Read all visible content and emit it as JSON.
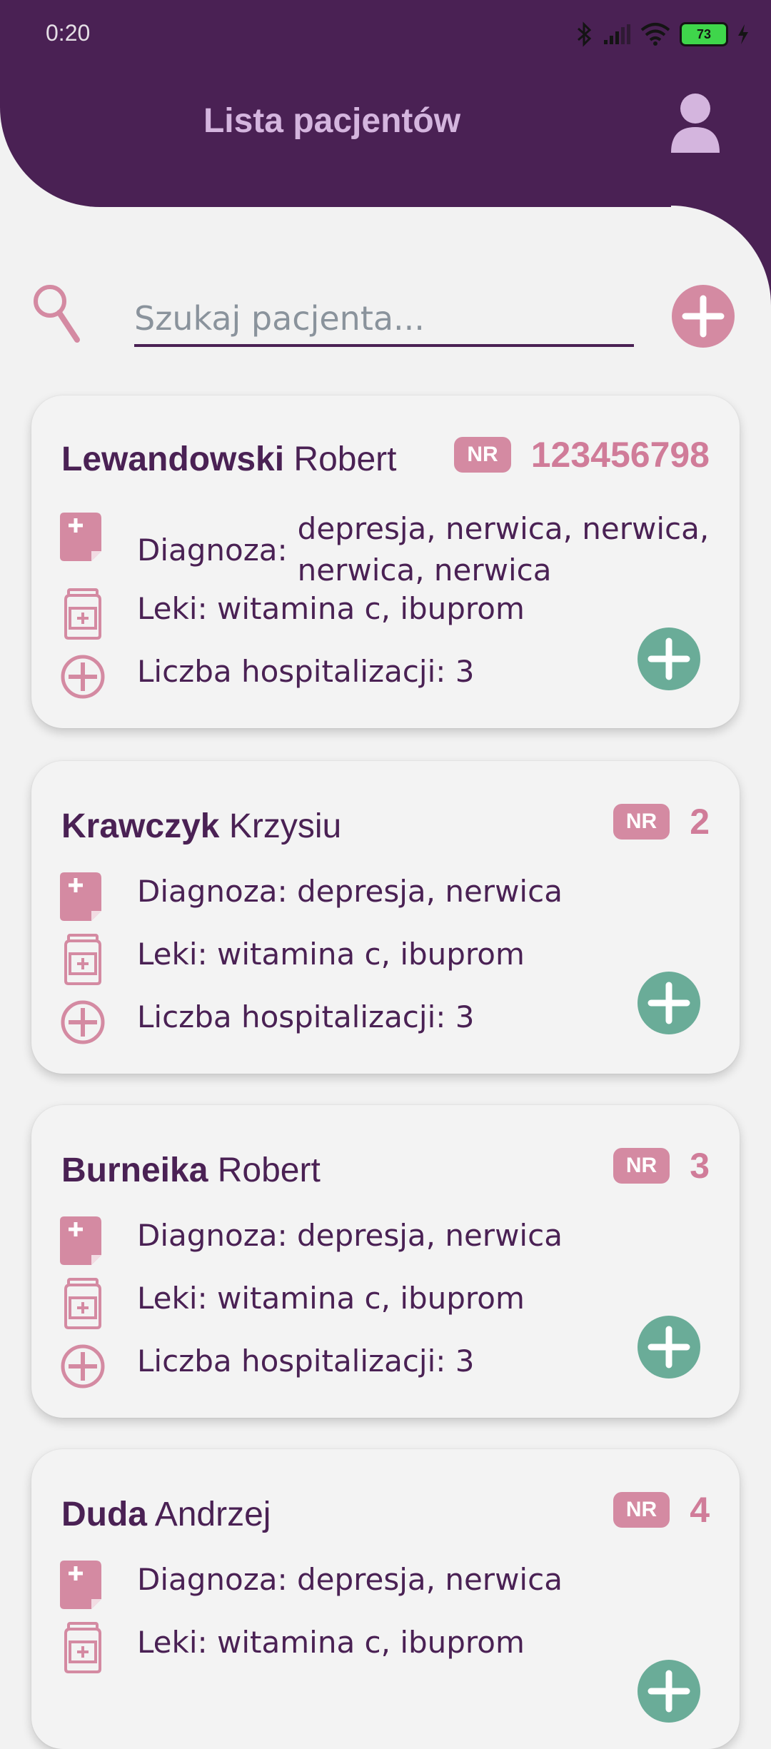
{
  "status_bar": {
    "time": "0:20",
    "battery": "73"
  },
  "header": {
    "title": "Lista pacjentów"
  },
  "search": {
    "placeholder": "Szukaj pacjenta..."
  },
  "labels": {
    "nr": "NR",
    "diagnosis": "Diagnoza:",
    "meds": "Leki:",
    "hospitalizations": "Liczba hospitalizacji:"
  },
  "colors": {
    "header_bg": "#4a2154",
    "accent_pink": "#d48aa2",
    "visit_green": "#6aac98",
    "text_dark": "#4a2154"
  },
  "patients": [
    {
      "surname": "Lewandowski",
      "first_name": "Robert",
      "nr": "123456798",
      "diagnosis_line1": "depresja, nerwica, nerwica,",
      "diagnosis_line2": "nerwica, nerwica",
      "meds": "witamina c, ibuprom",
      "hospitalizations": "3"
    },
    {
      "surname": "Krawczyk",
      "first_name": "Krzysiu",
      "nr": "2",
      "diagnosis": "depresja, nerwica",
      "meds": "witamina c, ibuprom",
      "hospitalizations": "3"
    },
    {
      "surname": "Burneika",
      "first_name": "Robert",
      "nr": "3",
      "diagnosis": "depresja, nerwica",
      "meds": "witamina c, ibuprom",
      "hospitalizations": "3"
    },
    {
      "surname": "Duda",
      "first_name": "Andrzej",
      "nr": "4",
      "diagnosis": "depresja, nerwica",
      "meds": "witamina c, ibuprom"
    }
  ]
}
